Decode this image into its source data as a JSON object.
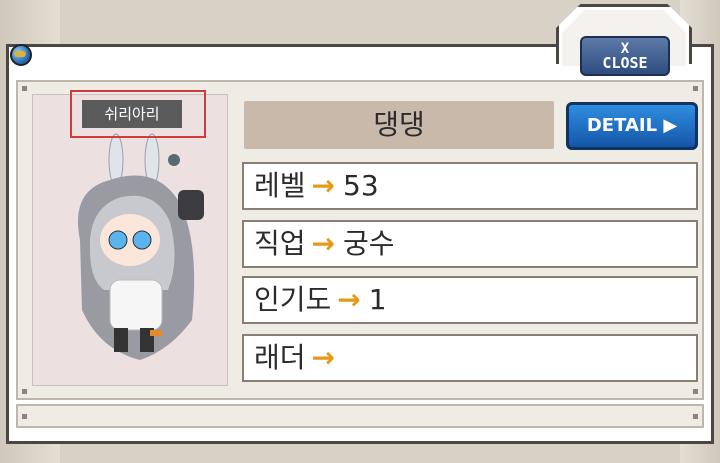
{
  "window": {
    "close_label": "CLOSE",
    "close_x": "X"
  },
  "profile": {
    "portrait_name_tag": "쉬리아리",
    "character_name": "댕댕",
    "detail_label": "DETAIL"
  },
  "stats": {
    "level_label": "레벨",
    "level_value": "53",
    "job_label": "직업",
    "job_value": "궁수",
    "fame_label": "인기도",
    "fame_value": "1",
    "ladder_label": "래더",
    "ladder_value": ""
  },
  "icons": {
    "arrow": "→",
    "detail_arrow": "▶"
  },
  "colors": {
    "detail_button": "#1a66c0",
    "arrow": "#e79a1a",
    "name_field": "#c9b9aa"
  }
}
